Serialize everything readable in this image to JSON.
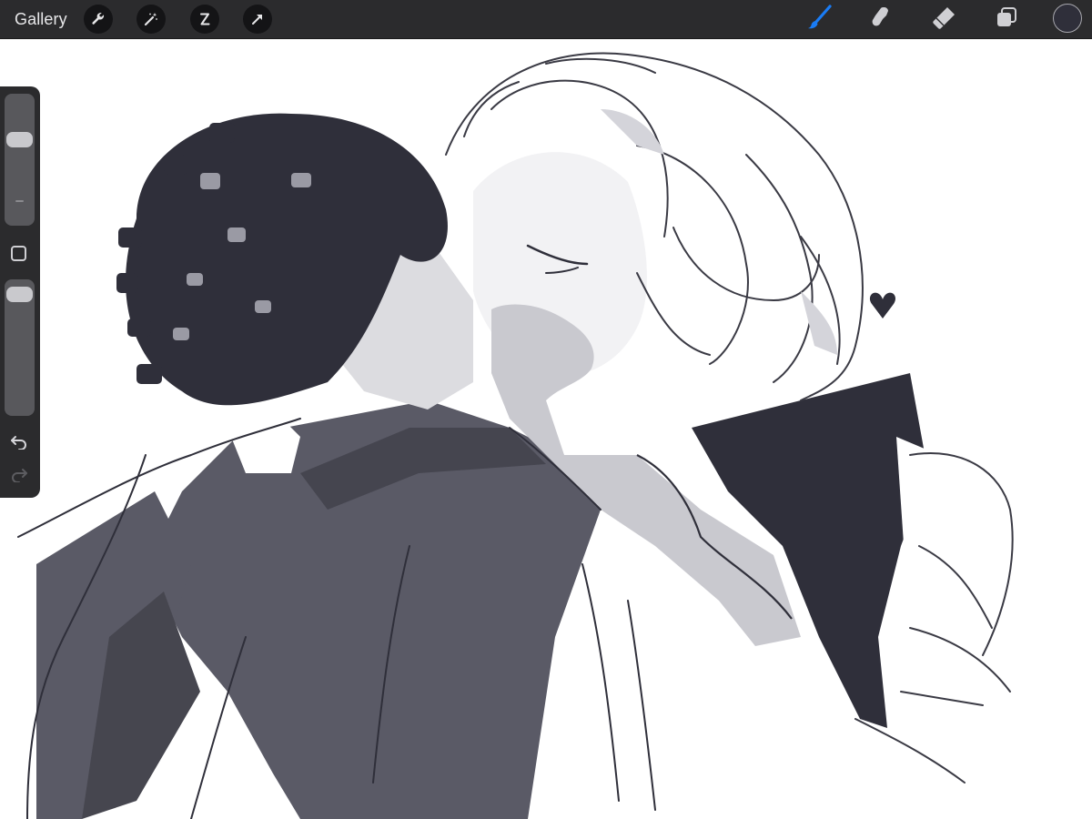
{
  "topbar": {
    "gallery_label": "Gallery",
    "left_tools": [
      {
        "name": "actions",
        "icon": "wrench-icon"
      },
      {
        "name": "adjustments",
        "icon": "magic-wand-icon"
      },
      {
        "name": "selection",
        "icon": "selection-s-icon"
      },
      {
        "name": "transform",
        "icon": "arrow-cursor-icon"
      }
    ],
    "right_tools": [
      {
        "name": "brush",
        "icon": "paintbrush-icon",
        "active": true
      },
      {
        "name": "smudge",
        "icon": "smudge-finger-icon",
        "active": false
      },
      {
        "name": "eraser",
        "icon": "eraser-icon",
        "active": false
      },
      {
        "name": "layers",
        "icon": "layers-icon",
        "active": false
      }
    ],
    "current_color": "#2f2f3a"
  },
  "sidebar": {
    "brush_size_level": 0.68,
    "opacity_level": 0.95,
    "modify_icon": "square-icon",
    "undo_icon": "undo-arrow-icon",
    "redo_icon": "redo-arrow-icon",
    "redo_enabled": false
  },
  "colors": {
    "toolbar_bg": "#2b2b2d",
    "active_tool": "#1a7cf5",
    "ink_dark": "#2f2f3a",
    "ink_mid": "#5a5a66",
    "ink_light": "#bcbcc4",
    "paper": "#ffffff"
  },
  "canvas": {
    "artwork": "sketch-illustration",
    "doodle": "heart-icon"
  }
}
